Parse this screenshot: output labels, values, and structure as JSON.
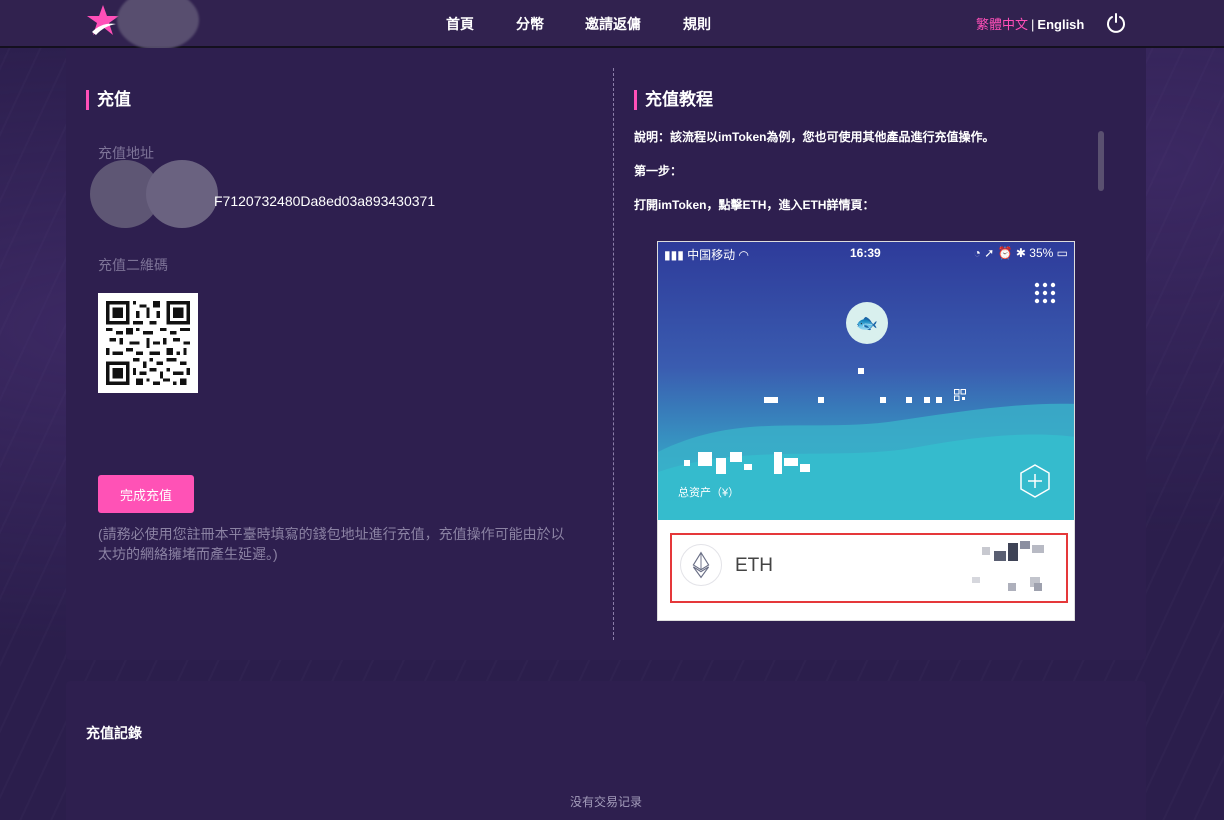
{
  "nav": {
    "items": [
      "首頁",
      "分幣",
      "邀請返傭",
      "規則"
    ],
    "lang_active": "繁體中文",
    "lang_sep": "|",
    "lang_other": "English"
  },
  "deposit": {
    "title": "充值",
    "address_label": "充值地址",
    "address_visible": "F7120732480Da8ed03a893430371",
    "qr_label": "充值二維碼",
    "done_button": "完成充值",
    "notice": "(請務必使用您註冊本平臺時填寫的錢包地址進行充值，充值操作可能由於以太坊的網絡擁堵而產生延遲。)"
  },
  "tutorial": {
    "title": "充值教程",
    "lines": [
      "說明：該流程以imToken為例，您也可使用其他產品進行充值操作。",
      "第一步：",
      "打開imToken，點擊ETH，進入ETH詳情頁："
    ],
    "phone": {
      "carrier": "中国移动",
      "time": "16:39",
      "battery": "35%",
      "assets_label": "总资产（¥）",
      "token_name": "ETH"
    }
  },
  "records": {
    "title": "充值記錄",
    "empty": "没有交易记录"
  },
  "colors": {
    "accent": "#ff52b6",
    "background": "#2b1e4c",
    "panel": "#2e1f4f",
    "highlight_border": "#e5383a"
  }
}
